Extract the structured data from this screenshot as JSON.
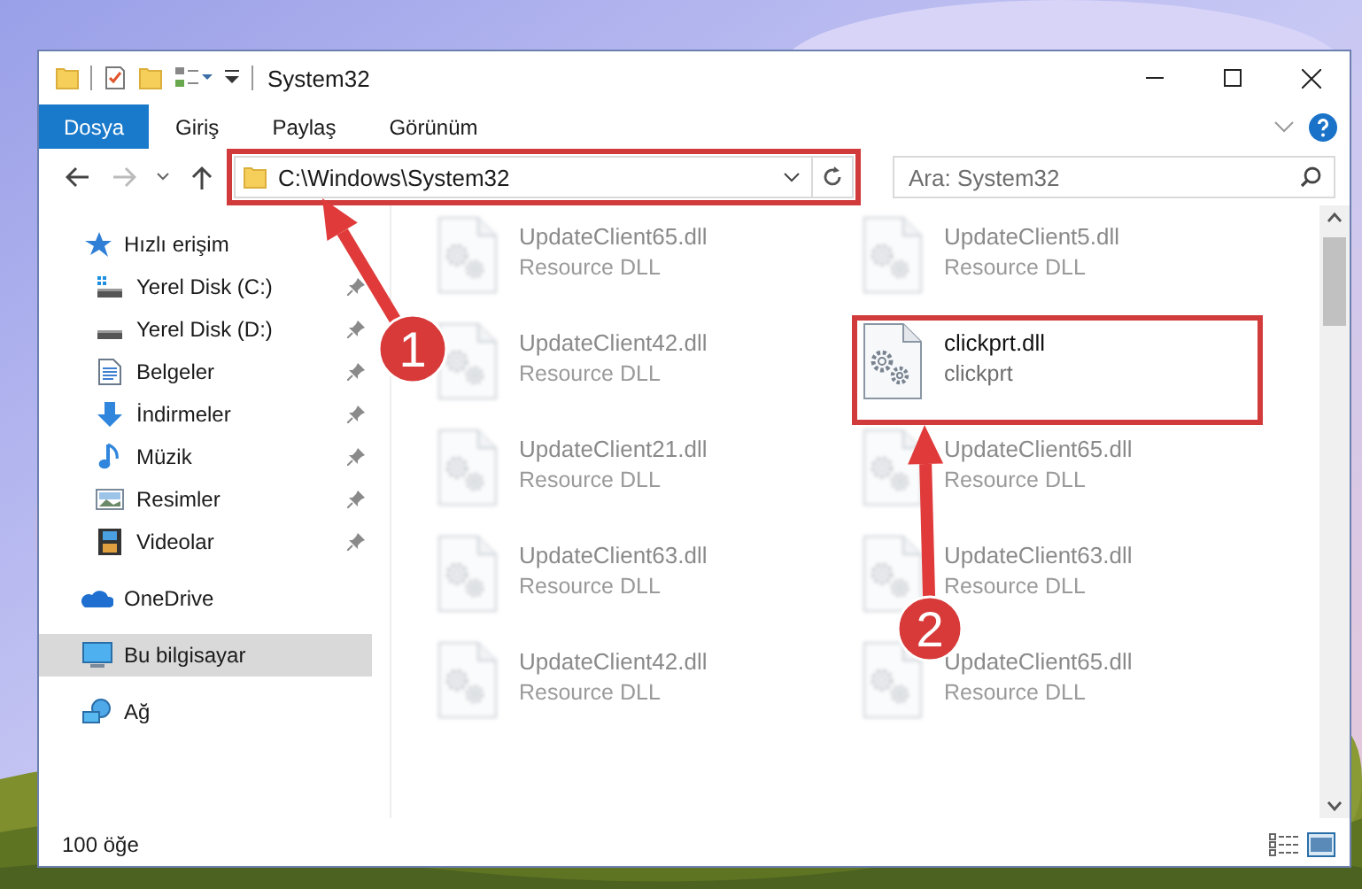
{
  "window": {
    "title": "System32"
  },
  "ribbon_tabs": [
    {
      "label": "Dosya",
      "selected": true
    },
    {
      "label": "Giriş",
      "selected": false
    },
    {
      "label": "Paylaş",
      "selected": false
    },
    {
      "label": "Görünüm",
      "selected": false
    }
  ],
  "address": {
    "path": "C:\\Windows\\System32",
    "marked": true
  },
  "search": {
    "placeholder": "Ara: System32"
  },
  "sidebar": {
    "items": [
      {
        "label": "Hızlı erişim",
        "kind": "star",
        "selected": false,
        "children": [
          {
            "label": "Yerel Disk (C:)",
            "kind": "drive-c",
            "pinned": true,
            "selected": false
          },
          {
            "label": "Yerel Disk (D:)",
            "kind": "drive",
            "pinned": true,
            "selected": false
          },
          {
            "label": "Belgeler",
            "kind": "docs",
            "pinned": true,
            "selected": false
          },
          {
            "label": "İndirmeler",
            "kind": "download",
            "pinned": true,
            "selected": false
          },
          {
            "label": "Müzik",
            "kind": "music",
            "pinned": true,
            "selected": false
          },
          {
            "label": "Resimler",
            "kind": "pictures",
            "pinned": true,
            "selected": false
          },
          {
            "label": "Videolar",
            "kind": "videos",
            "pinned": true,
            "selected": false
          }
        ]
      },
      {
        "label": "OneDrive",
        "kind": "cloud",
        "selected": false
      },
      {
        "label": "Bu bilgisayar",
        "kind": "pc",
        "selected": true
      },
      {
        "label": "Ağ",
        "kind": "network",
        "selected": false
      }
    ]
  },
  "files": [
    {
      "name": "UpdateClient65.dll",
      "type": "Resource DLL",
      "blurred": true,
      "marked": false
    },
    {
      "name": "UpdateClient5.dll",
      "type": "Resource DLL",
      "blurred": true,
      "marked": false
    },
    {
      "name": "UpdateClient42.dll",
      "type": "Resource DLL",
      "blurred": true,
      "marked": false
    },
    {
      "name": "clickprt.dll",
      "type": "clickprt",
      "blurred": false,
      "marked": true
    },
    {
      "name": "UpdateClient21.dll",
      "type": "Resource DLL",
      "blurred": true,
      "marked": false
    },
    {
      "name": "UpdateClient65.dll",
      "type": "Resource DLL",
      "blurred": true,
      "marked": false
    },
    {
      "name": "UpdateClient63.dll",
      "type": "Resource DLL",
      "blurred": true,
      "marked": false
    },
    {
      "name": "UpdateClient63.dll",
      "type": "Resource DLL",
      "blurred": true,
      "marked": false
    },
    {
      "name": "UpdateClient42.dll",
      "type": "Resource DLL",
      "blurred": true,
      "marked": false
    },
    {
      "name": "UpdateClient65.dll",
      "type": "Resource DLL",
      "blurred": true,
      "marked": false
    }
  ],
  "status_bar": {
    "count": "100 öğe"
  },
  "callouts": [
    {
      "number": "1"
    },
    {
      "number": "2"
    }
  ]
}
